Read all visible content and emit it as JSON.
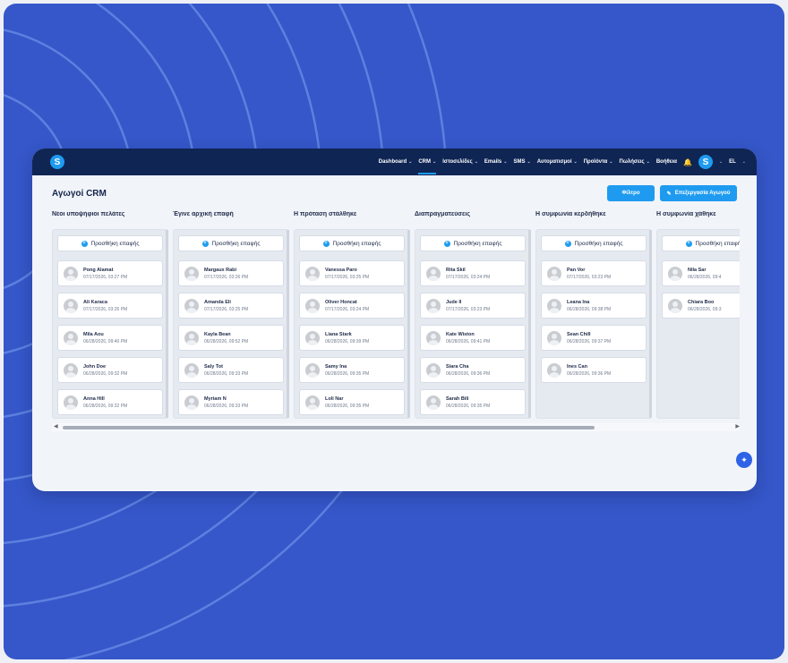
{
  "colors": {
    "background": "#3557c9",
    "navbar": "#0f2554",
    "accent": "#1e9bf0"
  },
  "nav": {
    "logo": "S",
    "items": [
      {
        "label": "Dashboard",
        "active": false
      },
      {
        "label": "CRM",
        "active": true
      },
      {
        "label": "Ιστοσελίδες",
        "active": false
      },
      {
        "label": "Emails",
        "active": false
      },
      {
        "label": "SMS",
        "active": false
      },
      {
        "label": "Αυτοματισμοί",
        "active": false
      },
      {
        "label": "Προϊόντα",
        "active": false
      },
      {
        "label": "Πωλήσεις",
        "active": false
      }
    ],
    "help": "Βοήθεια",
    "avatar": "S",
    "lang": "EL"
  },
  "page": {
    "title": "Αγωγοί CRM",
    "filter_label": "Φίλτρο",
    "edit_label": "Επεξεργασία Αγωγού"
  },
  "board": {
    "add_label": "Προσθήκη επαφής",
    "columns": [
      {
        "title": "Νέοι υποψήφιοι πελάτες",
        "cards": [
          {
            "name": "Pong Alamat",
            "date": "07/17/2026, 03:27 PM"
          },
          {
            "name": "Ali Karaca",
            "date": "07/17/2026, 03:26 PM"
          },
          {
            "name": "Mila Aou",
            "date": "06/28/2026, 09:40 PM"
          },
          {
            "name": "John Doe",
            "date": "06/28/2026, 09:32 PM"
          },
          {
            "name": "Anna Hill",
            "date": "06/28/2026, 09:32 PM"
          }
        ]
      },
      {
        "title": "Έγινε αρχική επαφή",
        "cards": [
          {
            "name": "Margaux Rabi",
            "date": "07/17/2026, 03:26 PM"
          },
          {
            "name": "Amanda Eli",
            "date": "07/17/2026, 03:25 PM"
          },
          {
            "name": "Kayla Bean",
            "date": "06/28/2026, 09:52 PM"
          },
          {
            "name": "Saly Tot",
            "date": "06/28/2026, 09:33 PM"
          },
          {
            "name": "Myriam N",
            "date": "06/28/2026, 09:33 PM"
          }
        ]
      },
      {
        "title": "Η πρόταση στάλθηκε",
        "cards": [
          {
            "name": "Vanessa Paro",
            "date": "07/17/2026, 03:25 PM"
          },
          {
            "name": "Oliver Honcat",
            "date": "07/17/2026, 03:24 PM"
          },
          {
            "name": "Liana Stark",
            "date": "06/28/2026, 09:39 PM"
          },
          {
            "name": "Samy Ina",
            "date": "06/28/2026, 09:35 PM"
          },
          {
            "name": "Loli Nar",
            "date": "06/28/2026, 09:35 PM"
          }
        ]
      },
      {
        "title": "Διαπραγματεύσεις",
        "cards": [
          {
            "name": "Rita Skil",
            "date": "07/17/2026, 03:24 PM"
          },
          {
            "name": "Jude Il",
            "date": "07/17/2026, 03:23 PM"
          },
          {
            "name": "Kate Wiston",
            "date": "06/28/2026, 09:41 PM"
          },
          {
            "name": "Siara Cha",
            "date": "06/28/2026, 09:36 PM"
          },
          {
            "name": "Sarah Bili",
            "date": "06/28/2026, 09:35 PM"
          }
        ]
      },
      {
        "title": "Η συμφωνία κερδήθηκε",
        "cards": [
          {
            "name": "Pan Vor",
            "date": "07/17/2026, 03:23 PM"
          },
          {
            "name": "Leana Ina",
            "date": "06/28/2026, 09:38 PM"
          },
          {
            "name": "Sean Chill",
            "date": "06/28/2026, 09:37 PM"
          },
          {
            "name": "Ines Can",
            "date": "06/28/2026, 09:36 PM"
          }
        ]
      },
      {
        "title": "Η συμφωνία χάθηκε",
        "cards": [
          {
            "name": "Nila Sar",
            "date": "06/28/2026, 09:4"
          },
          {
            "name": "Chiara Boo",
            "date": "06/28/2026, 09:3"
          }
        ]
      }
    ]
  }
}
